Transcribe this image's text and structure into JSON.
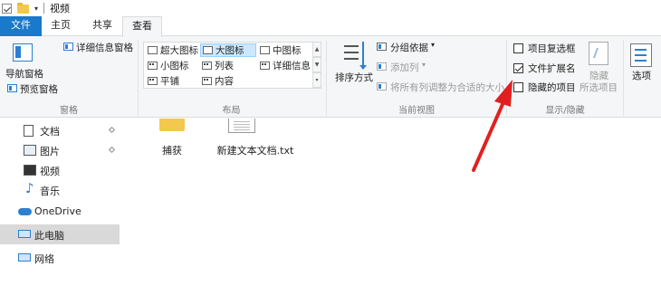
{
  "window": {
    "title": "视频"
  },
  "ribbon_tabs": {
    "file": "文件",
    "home": "主页",
    "share": "共享",
    "view": "查看"
  },
  "pane_group": {
    "details_pane": "详细信息窗格",
    "nav_pane_line1": "导航窗格",
    "preview_pane": "预览窗格",
    "label": "窗格"
  },
  "layout_group": {
    "items": [
      "超大图标",
      "大图标",
      "中图标",
      "小图标",
      "列表",
      "详细信息",
      "平铺",
      "内容"
    ],
    "selected": "大图标",
    "label": "布局"
  },
  "current_view_group": {
    "sort_by": "排序方式",
    "group_by": "分组依据",
    "add_column": "添加列",
    "fit_columns": "将所有列调整为合适的大小",
    "label": "当前视图"
  },
  "show_hide_group": {
    "item_checkboxes": {
      "label": "项目复选框",
      "checked": false
    },
    "file_extensions": {
      "label": "文件扩展名",
      "checked": true
    },
    "hidden_items": {
      "label": "隐藏的项目",
      "checked": false
    },
    "hide_selected_line1": "隐藏",
    "hide_selected_line2": "所选项目",
    "label": "显示/隐藏"
  },
  "options": {
    "label": "选项"
  },
  "nav_pane": {
    "quick_access": [
      {
        "label": "文档",
        "icon": "documents-icon"
      },
      {
        "label": "图片",
        "icon": "pictures-icon"
      },
      {
        "label": "视频",
        "icon": "videos-icon"
      },
      {
        "label": "音乐",
        "icon": "music-icon"
      }
    ],
    "onedrive": "OneDrive",
    "this_pc": "此电脑",
    "network": "网络"
  },
  "files": [
    {
      "name": "捕获",
      "type": "folder"
    },
    {
      "name": "新建文本文档.txt",
      "type": "text"
    }
  ],
  "colors": {
    "accent": "#1979ca",
    "annotation_arrow": "#e02020"
  }
}
